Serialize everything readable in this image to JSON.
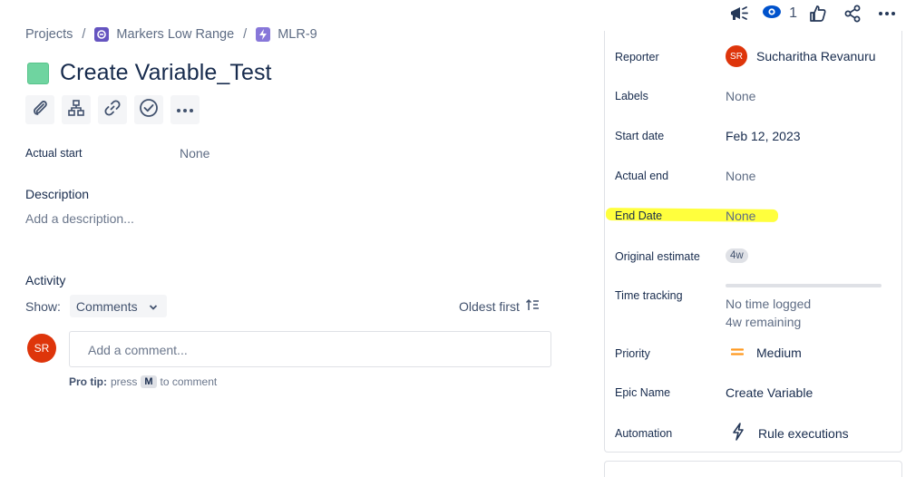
{
  "top_actions": {
    "announce_icon": "megaphone-icon",
    "watch_icon": "eye-icon",
    "watch_count": "1",
    "like_icon": "thumbs-up-icon",
    "share_icon": "share-icon",
    "more_icon": "more-icon"
  },
  "breadcrumb": {
    "projects": "Projects",
    "project": "Markers Low Range",
    "issue_key": "MLR-9"
  },
  "issue": {
    "title": "Create Variable_Test"
  },
  "toolbar": {
    "buttons": [
      "attach-icon",
      "child-issue-icon",
      "link-icon",
      "check-icon",
      "more-icon"
    ]
  },
  "fields": {
    "actual_start_label": "Actual start",
    "actual_start_value": "None"
  },
  "description": {
    "heading": "Description",
    "placeholder": "Add a description..."
  },
  "activity": {
    "heading": "Activity",
    "show_label": "Show:",
    "filter_value": "Comments",
    "sort_label": "Oldest first",
    "avatar_initials": "SR",
    "comment_placeholder": "Add a comment...",
    "protip_label": "Pro tip:",
    "protip_press": "press",
    "protip_key": "M",
    "protip_suffix": "to comment"
  },
  "details": {
    "reporter_label": "Reporter",
    "reporter_initials": "SR",
    "reporter_name": "Sucharitha Revanuru",
    "labels_label": "Labels",
    "labels_value": "None",
    "start_date_label": "Start date",
    "start_date_value": "Feb 12, 2023",
    "actual_end_label": "Actual end",
    "actual_end_value": "None",
    "end_date_label": "End Date",
    "end_date_value": "None",
    "original_estimate_label": "Original estimate",
    "original_estimate_value": "4w",
    "time_tracking_label": "Time tracking",
    "time_logged": "No time logged",
    "time_remaining": "4w remaining",
    "time_tracking_progress": 0,
    "priority_label": "Priority",
    "priority_value": "Medium",
    "priority_color": "#ff991f",
    "epic_name_label": "Epic Name",
    "epic_name_value": "Create Variable",
    "automation_label": "Automation",
    "automation_value": "Rule executions"
  },
  "colors": {
    "avatar": "#de350b",
    "project_icon": "#6554c0",
    "issue_key_icon": "#8777d9",
    "issue_type": "#6fd4a0",
    "highlight": "#ffff33"
  }
}
